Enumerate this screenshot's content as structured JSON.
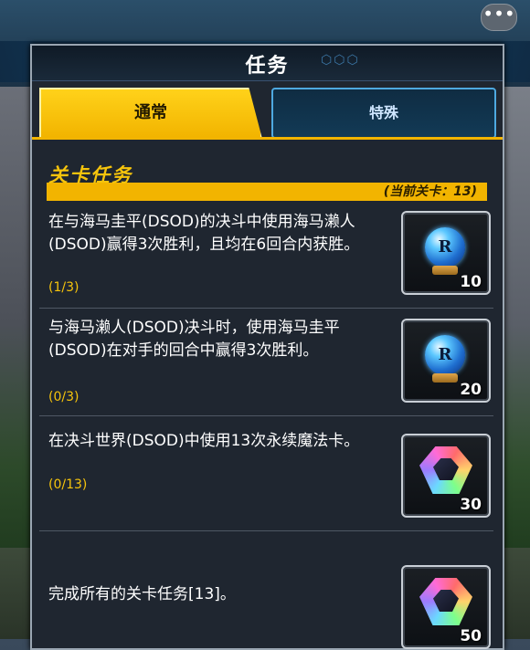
{
  "dialog": {
    "title": "任务",
    "tabs": [
      {
        "label": "通常",
        "active": true
      },
      {
        "label": "特殊",
        "active": false
      }
    ],
    "section": {
      "title": "关卡任务",
      "stage_info": "(当前关卡：13)"
    },
    "missions": [
      {
        "description": "在与海马圭平(DSOD)的决斗中使用海马濑人(DSOD)赢得3次胜利，且均在6回合内获胜。",
        "progress": "(1/3)",
        "reward": {
          "icon": "ticket-orb-icon",
          "count": "10"
        }
      },
      {
        "description": "与海马濑人(DSOD)决斗时，使用海马圭平(DSOD)在对手的回合中赢得3次胜利。",
        "progress": "(0/3)",
        "reward": {
          "icon": "ticket-orb-icon",
          "count": "20"
        }
      },
      {
        "description": "在决斗世界(DSOD)中使用13次永续魔法卡。",
        "progress": "(0/13)",
        "reward": {
          "icon": "gem-icon",
          "count": "30"
        }
      },
      {
        "description": "完成所有的关卡任务[13]。",
        "progress": "",
        "reward": {
          "icon": "gem-icon",
          "count": "50"
        }
      }
    ]
  },
  "orb_letter": "R",
  "colors": {
    "accent": "#f2b400",
    "progress": "#f6c40c",
    "panel": "#1f2630",
    "special_tab_border": "#4ea9e0"
  }
}
